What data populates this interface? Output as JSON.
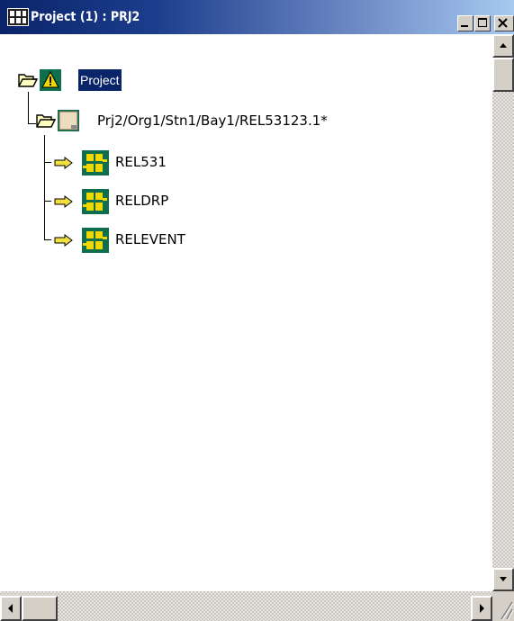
{
  "window": {
    "title": "Project (1) : PRJ2",
    "buttons": [
      "minimize",
      "maximize",
      "close"
    ]
  },
  "tree": {
    "root": {
      "label": "Project",
      "icon": "project-warning-icon",
      "selected": true,
      "children": [
        {
          "label": "Prj2/Org1/Stn1/Bay1/REL53123.1*",
          "icon": "ied-icon",
          "children": [
            {
              "label": "REL531",
              "icon": "function-block-icon"
            },
            {
              "label": "RELDRP",
              "icon": "function-block-icon"
            },
            {
              "label": "RELEVENT",
              "icon": "function-block-icon"
            }
          ]
        }
      ]
    }
  },
  "colors": {
    "title_start": "#0a246a",
    "title_end": "#a6caf0",
    "selection": "#0a246a",
    "folder": "#ffffc0",
    "icon_green": "#0e6e4e",
    "icon_yellow": "#f0d800",
    "arrow_yellow": "#f0e040"
  }
}
